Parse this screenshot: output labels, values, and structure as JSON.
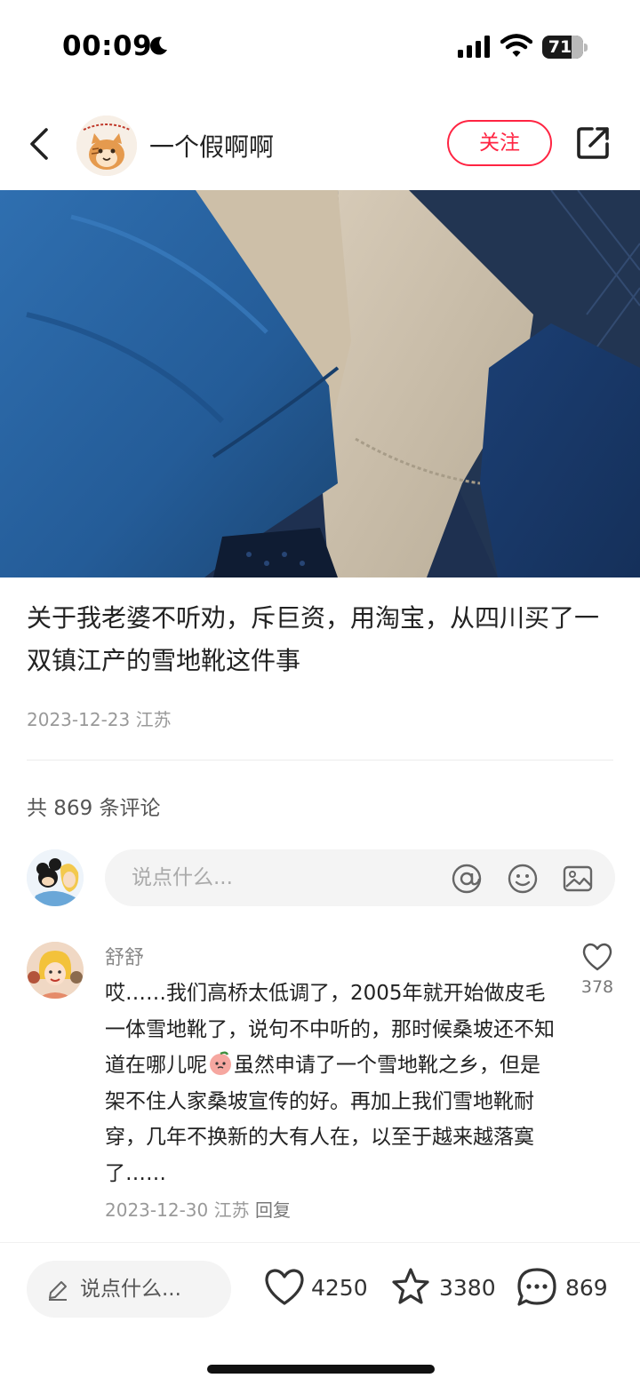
{
  "status_bar": {
    "time": "00:09",
    "battery": "71",
    "battery_level": 0.71
  },
  "nav": {
    "username": "一个假啊啊",
    "follow_label": "关注"
  },
  "post": {
    "title": "关于我老婆不听劝，斥巨资，用淘宝，从四川买了一双镇江产的雪地靴这件事",
    "date_location": "2023-12-23 江苏"
  },
  "comments_header": {
    "count_text": "共 869 条评论"
  },
  "comment_input": {
    "placeholder": "说点什么..."
  },
  "comment": {
    "author": "舒舒",
    "text_part1": "哎……我们高桥太低调了，2005年就开始做皮毛一体雪地靴了，说句不中听的，那时候桑坡还不知道在哪儿呢",
    "text_part2": "虽然申请了一个雪地靴之乡，但是架不住人家桑坡宣传的好。再加上我们雪地靴耐穿，几年不换新的大有人在，以至于越来越落寞了……",
    "date_location": "2023-12-30 江苏",
    "reply_label": "回复",
    "likes": "378"
  },
  "bottom_bar": {
    "input_placeholder": "说点什么...",
    "likes": "4250",
    "favorites": "3380",
    "comments": "869"
  },
  "colors": {
    "accent": "#ff2442",
    "muted": "#999999"
  }
}
